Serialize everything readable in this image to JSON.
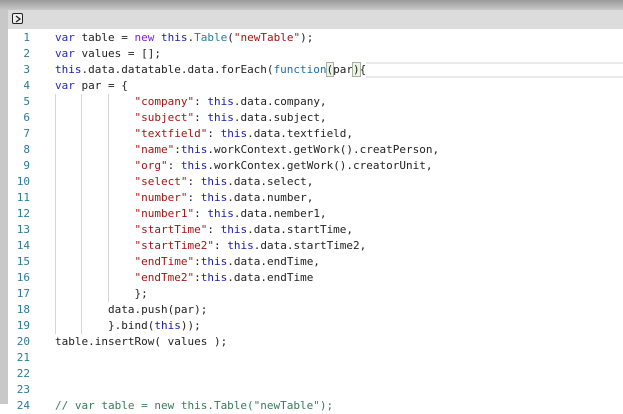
{
  "toolbar": {
    "toggle_icon": "chevron-right-icon"
  },
  "editor": {
    "active_line": 3,
    "lines": [
      {
        "n": "1",
        "indent": 0,
        "t": [
          [
            "var",
            "kw"
          ],
          " table = ",
          [
            "new",
            "nw"
          ],
          " ",
          [
            "this",
            "th"
          ],
          ".",
          [
            "Table",
            "ty"
          ],
          "(",
          [
            "\"newTable\"",
            "str"
          ],
          ");"
        ]
      },
      {
        "n": "2",
        "indent": 0,
        "t": [
          [
            "var",
            "kw"
          ],
          " values = [];"
        ]
      },
      {
        "n": "3",
        "indent": 0,
        "t": [
          [
            "this",
            "th"
          ],
          ".data.datatable.data.forEach(",
          [
            "function",
            "fn"
          ],
          [
            "(",
            "br"
          ],
          "par",
          [
            ")",
            "br"
          ],
          "{"
        ]
      },
      {
        "n": "4",
        "indent": 0,
        "t": [
          [
            "var",
            "kw"
          ],
          " par = {"
        ]
      },
      {
        "n": "5",
        "indent": 12,
        "t": [
          [
            "\"company\"",
            "str"
          ],
          ": ",
          [
            "this",
            "th"
          ],
          ".data.company,"
        ]
      },
      {
        "n": "6",
        "indent": 12,
        "t": [
          [
            "\"subject\"",
            "str"
          ],
          ": ",
          [
            "this",
            "th"
          ],
          ".data.subject,"
        ]
      },
      {
        "n": "7",
        "indent": 12,
        "t": [
          [
            "\"textfield\"",
            "str"
          ],
          ": ",
          [
            "this",
            "th"
          ],
          ".data.textfield,"
        ]
      },
      {
        "n": "8",
        "indent": 12,
        "t": [
          [
            "\"name\"",
            "str"
          ],
          ":",
          [
            "this",
            "th"
          ],
          ".workContext.getWork().creatPerson,"
        ]
      },
      {
        "n": "9",
        "indent": 12,
        "t": [
          [
            "\"org\"",
            "str"
          ],
          ": ",
          [
            "this",
            "th"
          ],
          ".workContex.getWork().creatorUnit,"
        ]
      },
      {
        "n": "10",
        "indent": 12,
        "t": [
          [
            "\"select\"",
            "str"
          ],
          ": ",
          [
            "this",
            "th"
          ],
          ".data.select,"
        ]
      },
      {
        "n": "11",
        "indent": 12,
        "t": [
          [
            "\"number\"",
            "str"
          ],
          ": ",
          [
            "this",
            "th"
          ],
          ".data.number,"
        ]
      },
      {
        "n": "12",
        "indent": 12,
        "t": [
          [
            "\"number1\"",
            "str"
          ],
          ": ",
          [
            "this",
            "th"
          ],
          ".data.nember1,"
        ]
      },
      {
        "n": "13",
        "indent": 12,
        "t": [
          [
            "\"startTime\"",
            "str"
          ],
          ": ",
          [
            "this",
            "th"
          ],
          ".data.startTime,"
        ]
      },
      {
        "n": "14",
        "indent": 12,
        "t": [
          [
            "\"startTime2\"",
            "str"
          ],
          ": ",
          [
            "this",
            "th"
          ],
          ".data.startTime2,"
        ]
      },
      {
        "n": "15",
        "indent": 12,
        "t": [
          [
            "\"endTime\"",
            "str"
          ],
          ":",
          [
            "this",
            "th"
          ],
          ".data.endTime,"
        ]
      },
      {
        "n": "16",
        "indent": 12,
        "t": [
          [
            "\"endTme2\"",
            "str"
          ],
          ":",
          [
            "this",
            "th"
          ],
          ".data.endTime"
        ]
      },
      {
        "n": "17",
        "indent": 12,
        "t": [
          "};"
        ]
      },
      {
        "n": "18",
        "indent": 8,
        "t": [
          "data.push(par);"
        ]
      },
      {
        "n": "19",
        "indent": 8,
        "t": [
          "}.bind(",
          [
            "this",
            "th"
          ],
          "));"
        ]
      },
      {
        "n": "20",
        "indent": 0,
        "t": [
          "table.insertRow( values );"
        ]
      },
      {
        "n": "21",
        "indent": 0,
        "t": []
      },
      {
        "n": "22",
        "indent": 0,
        "t": []
      },
      {
        "n": "23",
        "indent": 0,
        "t": []
      },
      {
        "n": "24",
        "indent": 0,
        "t": [
          [
            "// var table = new this.Table(\"newTable\");",
            "cm"
          ]
        ]
      }
    ]
  }
}
